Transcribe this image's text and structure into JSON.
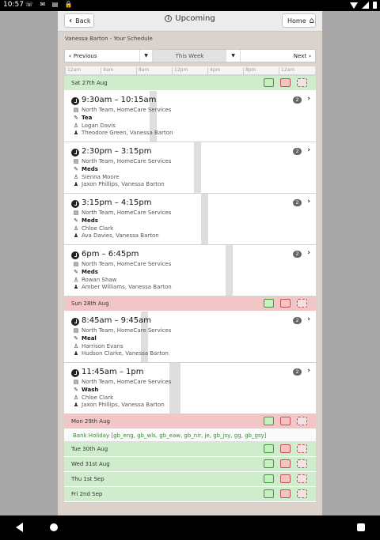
{
  "statusbar": {
    "time": "10:57",
    "icons": [
      "phone-icon",
      "message-icon",
      "sd-icon",
      "lock-icon"
    ],
    "right_icons": [
      "wifi-icon",
      "signal-icon",
      "battery-icon"
    ]
  },
  "topbar": {
    "back_label": "Back",
    "title": "Upcoming",
    "home_label": "Home"
  },
  "subtitle": "Vanessa Barton - Your Schedule",
  "week_nav": {
    "prev_label": "Previous",
    "current_label": "This Week",
    "next_label": "Next"
  },
  "time_ticks": [
    "12am",
    "4am",
    "8am",
    "12pm",
    "4pm",
    "8pm",
    "12am"
  ],
  "colors": {
    "confirmed_green": "#cfeccd",
    "unconfirmed_red": "#f2c6c6",
    "holiday_text": "#3b8a3b"
  },
  "days": [
    {
      "label": "Sat 27th Aug",
      "status": "green",
      "shifts": [
        {
          "time": "9:30am – 10:15am",
          "badge": "2",
          "team": "North Team, HomeCare Services",
          "task": "Tea",
          "client": "Logan Davis",
          "carers": "Theodore Green, Vanessa Barton"
        },
        {
          "time": "2:30pm – 3:15pm",
          "badge": "2",
          "team": "North Team, HomeCare Services",
          "task": "Meds",
          "client": "Sienna Moore",
          "carers": "Jaxon Phillips, Vanessa Barton"
        },
        {
          "time": "3:15pm – 4:15pm",
          "badge": "2",
          "team": "North Team, HomeCare Services",
          "task": "Meds",
          "client": "Chloe Clark",
          "carers": "Ava Davies, Vanessa Barton"
        },
        {
          "time": "6pm – 6:45pm",
          "badge": "2",
          "team": "North Team, HomeCare Services",
          "task": "Meds",
          "client": "Rowan Shaw",
          "carers": "Amber Williams, Vanessa Barton"
        }
      ]
    },
    {
      "label": "Sun 28th Aug",
      "status": "red",
      "shifts": [
        {
          "time": "8:45am – 9:45am",
          "badge": "2",
          "team": "North Team, HomeCare Services",
          "task": "Meal",
          "client": "Harrison Evans",
          "carers": "Hudson Clarke, Vanessa Barton"
        },
        {
          "time": "11:45am – 1pm",
          "badge": "2",
          "team": "North Team, HomeCare Services",
          "task": "Wash",
          "client": "Chloe Clark",
          "carers": "Jaxon Phillips, Vanessa Barton"
        }
      ]
    },
    {
      "label": "Mon 29th Aug",
      "status": "red",
      "holiday": "Bank Holiday [gb_eng, gb_wls, gb_eaw, gb_nir, je, gb_jsy, gg, gb_gsy]"
    },
    {
      "label": "Tue 30th Aug",
      "status": "green"
    },
    {
      "label": "Wed 31st Aug",
      "status": "green"
    },
    {
      "label": "Thu 1st Sep",
      "status": "green"
    },
    {
      "label": "Fri 2nd Sep",
      "status": "green"
    }
  ]
}
